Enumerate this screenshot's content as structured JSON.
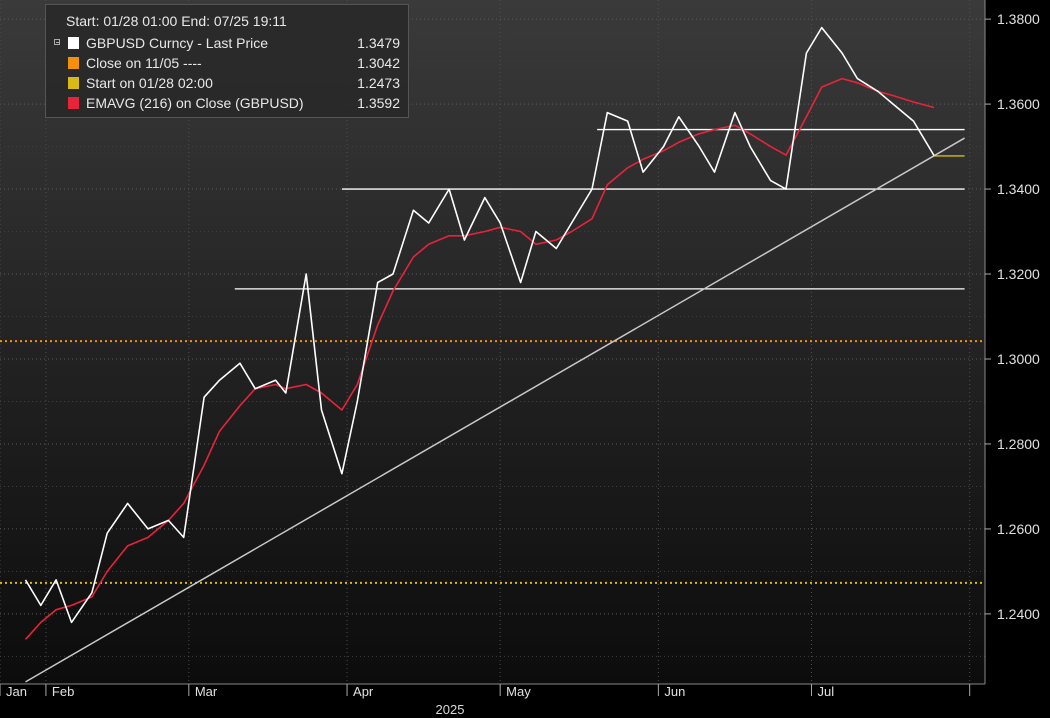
{
  "legend": {
    "header": "Start: 01/28 01:00 End: 07/25 19:11",
    "entries": [
      {
        "label": "GBPUSD Curncy - Last Price",
        "value": "1.3479",
        "color": "#ffffff"
      },
      {
        "label": "Close on 11/05 ----",
        "value": "1.3042",
        "color": "#f5900a"
      },
      {
        "label": "Start on 01/28 02:00",
        "value": "1.2473",
        "color": "#d9b914"
      },
      {
        "label": "EMAVG (216)  on Close (GBPUSD)",
        "value": "1.3592",
        "color": "#e8233a"
      }
    ]
  },
  "chart_data": {
    "type": "line",
    "yticks": [
      "1.3800",
      "1.3600",
      "1.3400",
      "1.3200",
      "1.3000",
      "1.2800",
      "1.2600",
      "1.2400"
    ],
    "ylim": [
      1.2235,
      1.3845
    ],
    "xticks": [
      "Jan",
      "Feb",
      "Mar",
      "Apr",
      "May",
      "Jun",
      "Jul"
    ],
    "xlabel": "2025",
    "x": [
      "2025-01-28",
      "2025-01-31",
      "2025-02-03",
      "2025-02-06",
      "2025-02-10",
      "2025-02-13",
      "2025-02-17",
      "2025-02-21",
      "2025-02-25",
      "2025-02-28",
      "2025-03-04",
      "2025-03-07",
      "2025-03-11",
      "2025-03-14",
      "2025-03-18",
      "2025-03-20",
      "2025-03-24",
      "2025-03-27",
      "2025-03-31",
      "2025-04-03",
      "2025-04-07",
      "2025-04-10",
      "2025-04-14",
      "2025-04-17",
      "2025-04-21",
      "2025-04-24",
      "2025-04-28",
      "2025-05-01",
      "2025-05-05",
      "2025-05-08",
      "2025-05-12",
      "2025-05-15",
      "2025-05-19",
      "2025-05-22",
      "2025-05-26",
      "2025-05-29",
      "2025-06-02",
      "2025-06-05",
      "2025-06-09",
      "2025-06-12",
      "2025-06-16",
      "2025-06-19",
      "2025-06-23",
      "2025-06-26",
      "2025-06-30",
      "2025-07-03",
      "2025-07-07",
      "2025-07-10",
      "2025-07-14",
      "2025-07-17",
      "2025-07-21",
      "2025-07-25"
    ],
    "series": [
      {
        "name": "GBPUSD Curncy - Last Price",
        "color": "#ffffff",
        "values": [
          1.248,
          1.242,
          1.248,
          1.238,
          1.245,
          1.259,
          1.266,
          1.26,
          1.262,
          1.258,
          1.291,
          1.295,
          1.299,
          1.293,
          1.295,
          1.292,
          1.32,
          1.288,
          1.273,
          1.29,
          1.318,
          1.32,
          1.335,
          1.332,
          1.34,
          1.328,
          1.338,
          1.332,
          1.318,
          1.33,
          1.326,
          1.332,
          1.34,
          1.358,
          1.356,
          1.344,
          1.35,
          1.357,
          1.35,
          1.344,
          1.358,
          1.35,
          1.342,
          1.34,
          1.372,
          1.378,
          1.372,
          1.366,
          1.363,
          1.36,
          1.356,
          1.3479
        ]
      },
      {
        "name": "EMAVG (216)  on Close (GBPUSD)",
        "color": "#e8233a",
        "values": [
          1.234,
          1.238,
          1.241,
          1.242,
          1.244,
          1.25,
          1.256,
          1.258,
          1.262,
          1.266,
          1.275,
          1.283,
          1.289,
          1.293,
          1.294,
          1.293,
          1.294,
          1.292,
          1.288,
          1.294,
          1.308,
          1.316,
          1.324,
          1.327,
          1.329,
          1.329,
          1.33,
          1.331,
          1.33,
          1.327,
          1.328,
          1.33,
          1.333,
          1.341,
          1.345,
          1.347,
          1.349,
          1.351,
          1.353,
          1.354,
          1.355,
          1.353,
          1.35,
          1.348,
          1.357,
          1.364,
          1.366,
          1.365,
          1.363,
          1.362,
          1.3605,
          1.3592
        ]
      }
    ],
    "reference_lines": [
      {
        "name": "Close on 11/05 ----",
        "value": 1.3042,
        "color": "#f5900a",
        "style": "dotted"
      },
      {
        "name": "Start on 01/28 02:00",
        "value": 1.2473,
        "color": "#d9b914",
        "style": "dotted"
      }
    ],
    "annotations": {
      "horizontal_levels": [
        {
          "value": 1.354,
          "from": "2025-05-20",
          "to": "2025-07-31",
          "color": "#ffffff"
        },
        {
          "value": 1.34,
          "from": "2025-03-31",
          "to": "2025-07-31",
          "color": "#ffffff"
        },
        {
          "value": 1.3165,
          "from": "2025-03-10",
          "to": "2025-07-31",
          "color": "#ffffff"
        },
        {
          "value": 1.3478,
          "from": "2025-07-25",
          "to": "2025-07-31",
          "color": "#d9b914"
        }
      ],
      "trendline": {
        "from": [
          "2025-01-28",
          1.224
        ],
        "to": [
          "2025-07-31",
          1.352
        ],
        "color": "#c8c8c8"
      }
    },
    "grid": true,
    "legend_position": "top-left"
  }
}
